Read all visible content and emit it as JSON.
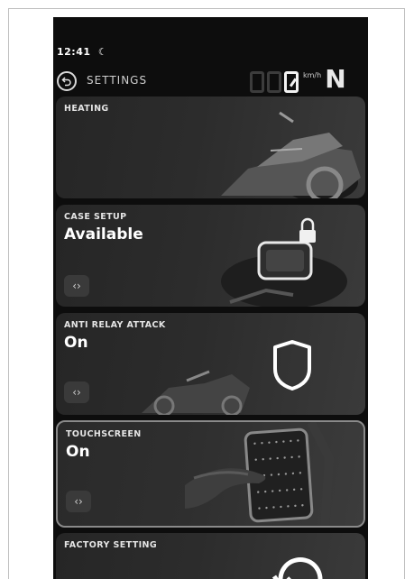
{
  "status": {
    "time": "12:41",
    "mode_icon": "moon-icon"
  },
  "header": {
    "title": "SETTINGS",
    "back_icon": "back-arrow-icon"
  },
  "speedometer": {
    "digits_shown": 3,
    "unit": "km/h",
    "gear": "N"
  },
  "cards": [
    {
      "label": "HEATING",
      "value": "",
      "illustration": "motorcycle-image"
    },
    {
      "label": "CASE SETUP",
      "value": "Available",
      "nav": "‹›",
      "illustration": "case-lock-image"
    },
    {
      "label": "ANTI RELAY ATTACK",
      "value": "On",
      "nav": "‹›",
      "illustration": "shield-icon"
    },
    {
      "label": "TOUCHSCREEN",
      "value": "On",
      "nav": "‹›",
      "illustration": "touchscreen-glove-image",
      "selected": true
    },
    {
      "label": "FACTORY SETTING",
      "value": "",
      "illustration": "reset-icon"
    }
  ],
  "colors": {
    "background": "#0d0d0d",
    "card": "#2c2c2c",
    "text": "#ffffff",
    "accent": "#e8e8e8"
  }
}
